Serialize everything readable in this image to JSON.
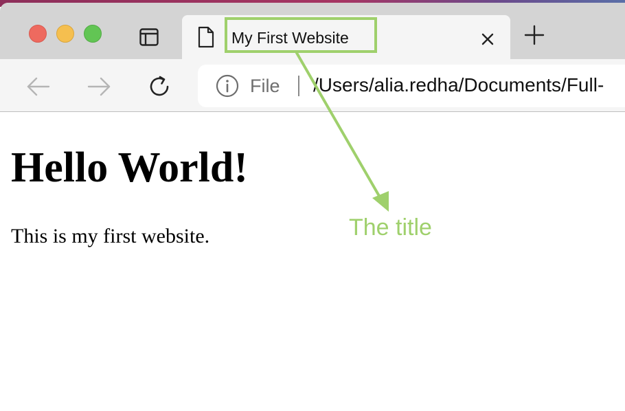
{
  "browser": {
    "tab": {
      "title": "My First Website"
    },
    "address_bar": {
      "scheme_label": "File",
      "path": "/Users/alia.redha/Documents/Full-"
    },
    "icons": {
      "info": "info-icon",
      "document": "document-icon",
      "sidebar": "sidebar-icon",
      "close": "close-icon",
      "new_tab": "plus-icon",
      "back": "arrow-left-icon",
      "forward": "arrow-right-icon",
      "reload": "reload-icon"
    }
  },
  "page": {
    "heading": "Hello World!",
    "paragraph": "This is my first website."
  },
  "annotation": {
    "label": "The title",
    "color": "#9fd06c"
  },
  "colors": {
    "traffic_red": "#ee6a5f",
    "traffic_yellow": "#f5bf4f",
    "traffic_green": "#62c554",
    "tabbar": "#d4d4d4",
    "toolbar": "#f5f5f5"
  }
}
